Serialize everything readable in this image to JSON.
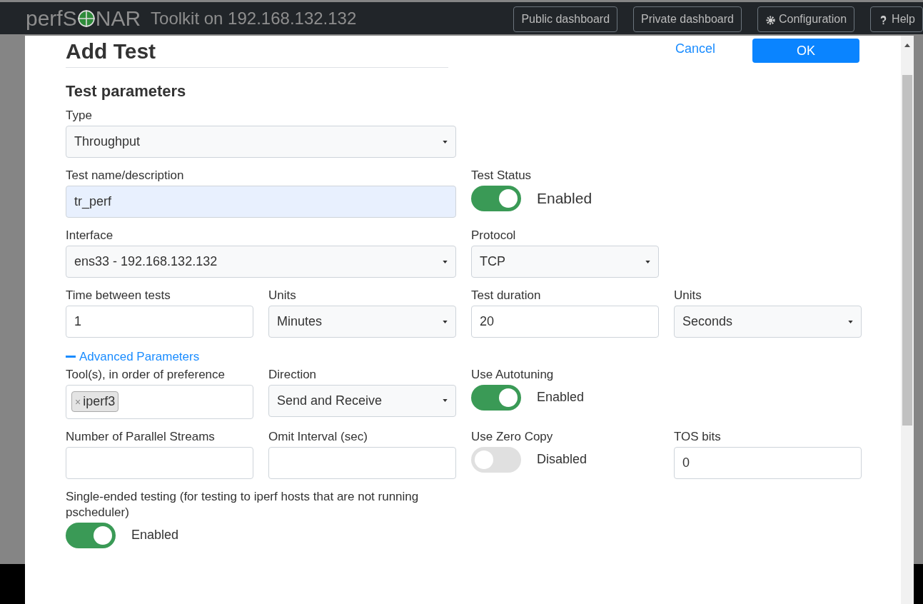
{
  "header": {
    "brand_left": "perfS",
    "brand_right": "NAR",
    "subtitle": "Toolkit on 192.168.132.132",
    "buttons": [
      {
        "label": "Public dashboard",
        "kind": "plain"
      },
      {
        "label": "Private dashboard",
        "kind": "plain"
      },
      {
        "label": "Configuration",
        "kind": "gear"
      },
      {
        "label": "Help",
        "kind": "help"
      }
    ]
  },
  "modal": {
    "title": "Add Test",
    "cancel": "Cancel",
    "ok": "OK",
    "section_title": "Test parameters",
    "rows": [
      [
        {
          "kind": "select",
          "label": "Type",
          "value": "Throughput",
          "wide": true
        }
      ],
      [
        {
          "kind": "input",
          "label": "Test name/description",
          "value": "tr_perf",
          "autofilled": true,
          "wide": true
        },
        {
          "kind": "toggle",
          "label": "Test Status",
          "on": true,
          "state_text": "Enabled"
        }
      ],
      [
        {
          "kind": "select",
          "label": "Interface",
          "value": "ens33 - 192.168.132.132",
          "wide": true
        },
        {
          "kind": "select",
          "label": "Protocol",
          "value": "TCP"
        }
      ],
      [
        {
          "kind": "input",
          "label": "Time between tests",
          "value": "1"
        },
        {
          "kind": "select",
          "label": "Units",
          "value": "Minutes"
        },
        {
          "kind": "input",
          "label": "Test duration",
          "value": "20"
        },
        {
          "kind": "select",
          "label": "Units",
          "value": "Seconds"
        }
      ],
      [
        {
          "kind": "link",
          "label": "Advanced Parameters",
          "expanded": true
        }
      ],
      [
        {
          "kind": "tags",
          "label": "Tool(s), in order of preference",
          "tags": [
            {
              "remove": "×",
              "text": "iperf3"
            }
          ]
        },
        {
          "kind": "select",
          "label": "Direction",
          "value": "Send and Receive"
        },
        {
          "kind": "toggle",
          "label": "Use Autotuning",
          "on": true,
          "state_text": "Enabled"
        }
      ],
      [
        {
          "kind": "input",
          "label": "Number of Parallel Streams"
        },
        {
          "kind": "input",
          "label": "Omit Interval (sec)"
        },
        {
          "kind": "toggle",
          "label": "Use Zero Copy",
          "on": false,
          "state_text": "Disabled"
        },
        {
          "kind": "input",
          "label": "TOS bits",
          "value": "0"
        }
      ],
      [
        {
          "kind": "toggle",
          "label": "Single-ended testing (for testing to iperf hosts that are not running pscheduler)",
          "on": true,
          "state_text": "Enabled",
          "wide": true
        }
      ]
    ]
  }
}
